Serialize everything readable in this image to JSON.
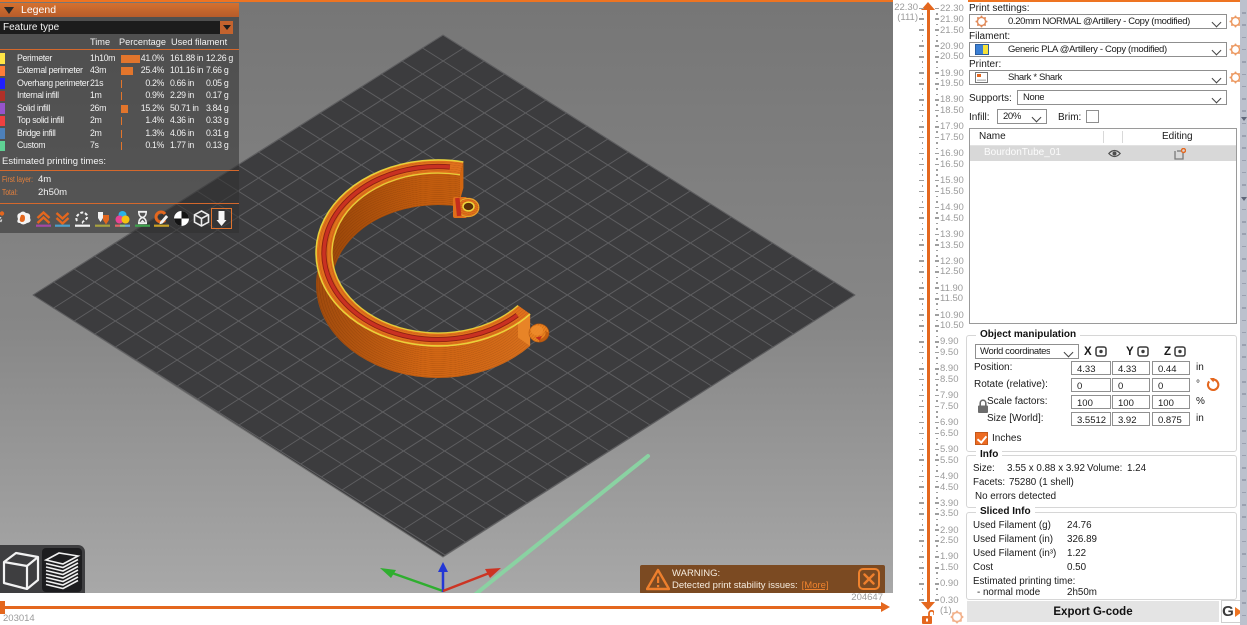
{
  "app": {
    "accent": "#ED6B22"
  },
  "legend": {
    "title": "Legend",
    "feature_type_label": "Feature type",
    "columns": {
      "time": "Time",
      "percentage": "Percentage",
      "used_filament": "Used filament"
    },
    "rows": [
      {
        "color": "#FFE646",
        "label": "Perimeter",
        "time": "1h10m",
        "pct": 41.0,
        "pct_label": "41.0%",
        "filament": "161.88 in",
        "weight": "12.26 g"
      },
      {
        "color": "#FF7D38",
        "label": "External perimeter",
        "time": "43m",
        "pct": 25.4,
        "pct_label": "25.4%",
        "filament": "101.16 in",
        "weight": "7.66 g"
      },
      {
        "color": "#1F1FFF",
        "label": "Overhang perimeter",
        "time": "21s",
        "pct": 0.2,
        "pct_label": "0.2%",
        "filament": "0.66 in",
        "weight": "0.05 g"
      },
      {
        "color": "#B03028",
        "label": "Internal infill",
        "time": "1m",
        "pct": 0.9,
        "pct_label": "0.9%",
        "filament": "2.29 in",
        "weight": "0.17 g"
      },
      {
        "color": "#9654CC",
        "label": "Solid infill",
        "time": "26m",
        "pct": 15.2,
        "pct_label": "15.2%",
        "filament": "50.71 in",
        "weight": "3.84 g"
      },
      {
        "color": "#F04040",
        "label": "Top solid infill",
        "time": "2m",
        "pct": 1.4,
        "pct_label": "1.4%",
        "filament": "4.36 in",
        "weight": "0.33 g"
      },
      {
        "color": "#4D80BA",
        "label": "Bridge infill",
        "time": "2m",
        "pct": 1.3,
        "pct_label": "1.3%",
        "filament": "4.06 in",
        "weight": "0.31 g"
      },
      {
        "color": "#5FD194",
        "label": "Custom",
        "time": "7s",
        "pct": 0.1,
        "pct_label": "0.1%",
        "filament": "1.77 in",
        "weight": "0.13 g"
      }
    ],
    "estimated_title": "Estimated printing times:",
    "first_layer_label": "First layer:",
    "first_layer_value": "4m",
    "total_label": "Total:",
    "total_value": "2h50m",
    "toolbar_icons": [
      "travels",
      "wipe",
      "retractions",
      "deretractions",
      "seams",
      "tool-changes",
      "color-changes",
      "pause-prints",
      "custom-gcodes",
      "center-of-gravity",
      "shells",
      "tool-marker"
    ],
    "toolbar_selected": "tool-marker"
  },
  "viewport": {
    "warning": {
      "title": "WARNING:",
      "message": "Detected print stability issues:",
      "link": "[More]"
    },
    "view_buttons": [
      "3d-editor-view",
      "preview-view"
    ],
    "active_view": "preview-view"
  },
  "hslider": {
    "min_label": "203014",
    "max_label": "204647"
  },
  "layer_slider": {
    "top_value": "22.30",
    "top_layer": "(111)",
    "bottom_value": "0.30",
    "bottom_layer": "(1)",
    "z_min": 0.3,
    "z_max": 22.3,
    "z_step": 0.2,
    "tick_labels": [
      "22.30",
      "21.90",
      "21.50",
      "20.90",
      "20.50",
      "19.90",
      "19.50",
      "18.90",
      "18.50",
      "17.90",
      "17.50",
      "16.90",
      "16.50",
      "15.90",
      "15.50",
      "14.90",
      "14.50",
      "13.90",
      "13.50",
      "12.90",
      "12.50",
      "11.90",
      "11.50",
      "10.90",
      "10.50",
      "9.90",
      "9.50",
      "8.90",
      "8.50",
      "7.90",
      "7.50",
      "6.90",
      "6.50",
      "5.90",
      "5.50",
      "4.90",
      "4.50",
      "3.90",
      "3.50",
      "2.90",
      "2.50",
      "1.90",
      "1.50",
      "0.90",
      "0.30"
    ]
  },
  "panel": {
    "print_settings_label": "Print settings:",
    "print_settings_value": "0.20mm NORMAL @Artillery - Copy (modified)",
    "filament_label": "Filament:",
    "filament_value": "Generic PLA @Artillery - Copy (modified)",
    "printer_label": "Printer:",
    "printer_value": "Shark * Shark",
    "supports_label": "Supports:",
    "supports_value": "None",
    "infill_label": "Infill:",
    "infill_value": "20%",
    "brim_label": "Brim:",
    "objects_table": {
      "name_col": "Name",
      "editing_col": "Editing",
      "rows": [
        {
          "name": "BourdonTube_01"
        }
      ]
    },
    "manipulation": {
      "title": "Object manipulation",
      "coords_value": "World coordinates",
      "axes": [
        "X",
        "Y",
        "Z"
      ],
      "rows": [
        {
          "label": "Position:",
          "x": "4.33",
          "y": "4.33",
          "z": "0.44",
          "unit": "in",
          "indent": false,
          "reset": false
        },
        {
          "label": "Rotate (relative):",
          "x": "0",
          "y": "0",
          "z": "0",
          "unit": "°",
          "indent": false,
          "reset": true
        },
        {
          "label": "Scale factors:",
          "x": "100",
          "y": "100",
          "z": "100",
          "unit": "%",
          "indent": true,
          "reset": false
        },
        {
          "label": "Size [World]:",
          "x": "3.5512",
          "y": "3.92",
          "z": "0.875",
          "unit": "in",
          "indent": true,
          "reset": false
        }
      ],
      "inches_label": "Inches"
    },
    "info": {
      "title": "Info",
      "size_label": "Size:",
      "size_value": "3.55 x 0.88 x 3.92",
      "volume_label": "Volume:",
      "volume_value": "1.24",
      "facets_label": "Facets:",
      "facets_value": "75280 (1 shell)",
      "errors_value": "No errors detected"
    },
    "sliced": {
      "title": "Sliced Info",
      "rows": [
        {
          "label": "Used Filament (g)",
          "value": "24.76"
        },
        {
          "label": "Used Filament (in)",
          "value": "326.89"
        },
        {
          "label": "Used Filament (in³)",
          "value": "1.22"
        },
        {
          "label": "Cost",
          "value": "0.50"
        },
        {
          "label": "Estimated printing time:",
          "value": ""
        },
        {
          "label": "- normal mode",
          "value": "2h50m"
        }
      ]
    },
    "export_button": "Export G-code"
  },
  "object_name": "BourdonTube_01"
}
